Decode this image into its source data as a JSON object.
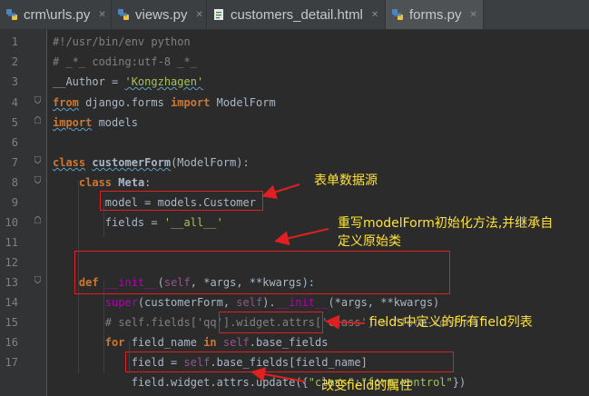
{
  "tabs": [
    {
      "label": "crm\\urls.py",
      "icon": "python-file-icon",
      "active": false
    },
    {
      "label": "views.py",
      "icon": "python-file-icon",
      "active": false
    },
    {
      "label": "customers_detail.html",
      "icon": "html-file-icon",
      "active": false
    },
    {
      "label": "forms.py",
      "icon": "python-file-icon",
      "active": true
    }
  ],
  "editor": {
    "line_numbers": [
      "1",
      "2",
      "3",
      "4",
      "5",
      "6",
      "7",
      "8",
      "9",
      "10",
      "11",
      "12",
      "13",
      "14",
      "15",
      "16",
      "17"
    ],
    "code": {
      "l1": "#!/usr/bin/env python",
      "l2": "# _*_ coding:utf-8 _*_",
      "l3a": "__Author = ",
      "l3b": "'Kongzhagen'",
      "l4a": "from",
      "l4b": " django.forms ",
      "l4c": "import",
      "l4d": " ModelForm",
      "l5a": "import",
      "l5b": " models",
      "l7a": "class",
      "l7b": "customerForm",
      "l7c": "(ModelForm):",
      "l8a": "class",
      "l8b": "Meta",
      "l8c": ":",
      "l9": "model = models.Customer",
      "l10a": "fields = ",
      "l10b": "'__all__'",
      "l12a": "def",
      "l12b": "__init__",
      "l12c": "(",
      "l12d": "self",
      "l12e": ", *args, **kwargs):",
      "l13a": "super",
      "l13b": "(customerForm, ",
      "l13c": "self",
      "l13d": ").",
      "l13e": "__init__",
      "l13f": "(*args, **kwargs)",
      "l14": "# self.fields['qq'].widget.attrs['class'] = \"form-control\"",
      "l15a": "for",
      "l15b": " field_name ",
      "l15c": "in",
      "l15d": "self",
      "l15e": ".base_fields",
      "l16a": "field = ",
      "l16b": "self",
      "l16c": ".base_fields[field_name]",
      "l17a": "field.widget.attrs.update({",
      "l17b": "\"class\"",
      "l17c": ":",
      "l17d": "\"form-control\"",
      "l17e": "})"
    }
  },
  "annotations": {
    "a1": "表单数据源",
    "a2_line1": "重写modelForm初始化方法,并继承自",
    "a2_line2": "定义原始类",
    "a3": "fields中定义的所有field列表",
    "a4": "改变field的属性"
  },
  "colors": {
    "annotation_text": "#ffe23a",
    "annotation_box": "#e02020",
    "background": "#2b2b2b"
  }
}
